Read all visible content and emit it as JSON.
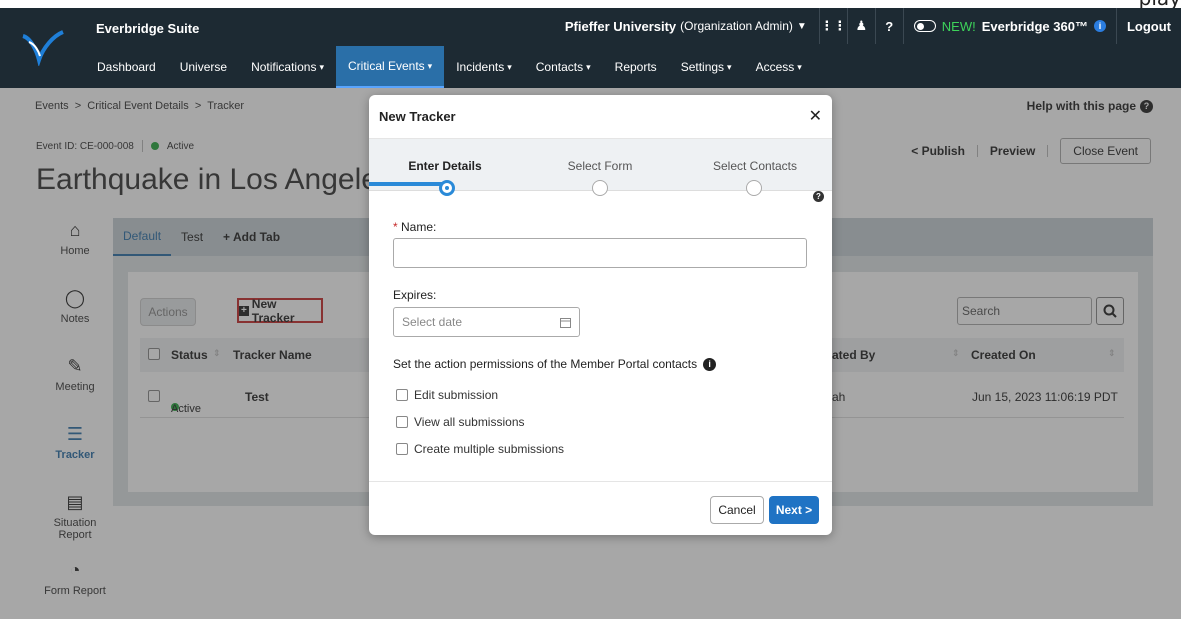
{
  "top_strip_text": "play",
  "header": {
    "brand": "Everbridge Suite",
    "org_name": "Pfieffer University",
    "org_role": "(Organization Admin)",
    "new_tag": "NEW!",
    "e360_label": "Everbridge 360™",
    "logout": "Logout"
  },
  "nav": [
    {
      "label": "Dashboard",
      "dropdown": ""
    },
    {
      "label": "Universe",
      "dropdown": ""
    },
    {
      "label": "Notifications",
      "dropdown": "▾"
    },
    {
      "label": "Critical Events",
      "dropdown": "▾"
    },
    {
      "label": "Incidents",
      "dropdown": "▾"
    },
    {
      "label": "Contacts",
      "dropdown": "▾"
    },
    {
      "label": "Reports",
      "dropdown": ""
    },
    {
      "label": "Settings",
      "dropdown": "▾"
    },
    {
      "label": "Access",
      "dropdown": "▾"
    }
  ],
  "breadcrumb": "Events  >  Critical Event Details  >  Tracker",
  "help": "Help with this page",
  "event": {
    "id": "Event ID: CE-000-008",
    "status": "Active",
    "title": "Earthquake in Los Angeles"
  },
  "event_actions": {
    "publish": "Publish",
    "preview": "Preview",
    "close": "Close Event"
  },
  "sidebar": [
    {
      "label": "Home",
      "icon": "home-icon"
    },
    {
      "label": "Notes",
      "icon": "comment-icon"
    },
    {
      "label": "Meeting",
      "icon": "meeting-icon"
    },
    {
      "label": "Tracker",
      "icon": "list-icon"
    },
    {
      "label": "Situation Report",
      "icon": "report-icon"
    },
    {
      "label": "Form Report",
      "icon": "pie-icon"
    }
  ],
  "tabs": [
    "Default",
    "Test",
    "+ Add Tab"
  ],
  "toolbar": {
    "actions": "Actions",
    "new_tracker": "New Tracker",
    "search_placeholder": "Search"
  },
  "table": {
    "headers": {
      "status": "Status",
      "name": "Tracker Name",
      "created_by": "ated By",
      "created_on": "Created On"
    },
    "rows": [
      {
        "status": "Active",
        "name": "Test",
        "created_by": "ah",
        "created_on": "Jun 15, 2023 11:06:19 PDT"
      }
    ]
  },
  "modal": {
    "title": "New Tracker",
    "steps": [
      "Enter Details",
      "Select Form",
      "Select Contacts"
    ],
    "current_step": 1,
    "name_label": "Name:",
    "required_mark": "*",
    "expires_label": "Expires:",
    "date_placeholder": "Select date",
    "permissions_label": "Set the action permissions of the Member Portal contacts",
    "checkboxes": [
      "Edit submission",
      "View all submissions",
      "Create multiple submissions"
    ],
    "cancel": "Cancel",
    "next": "Next >"
  },
  "colors": {
    "header_bg": "#1d2a33",
    "accent": "#2a6fa8",
    "next_button": "#1f73c4",
    "active_status": "#25a83c",
    "highlight_border": "#c62a2a"
  }
}
